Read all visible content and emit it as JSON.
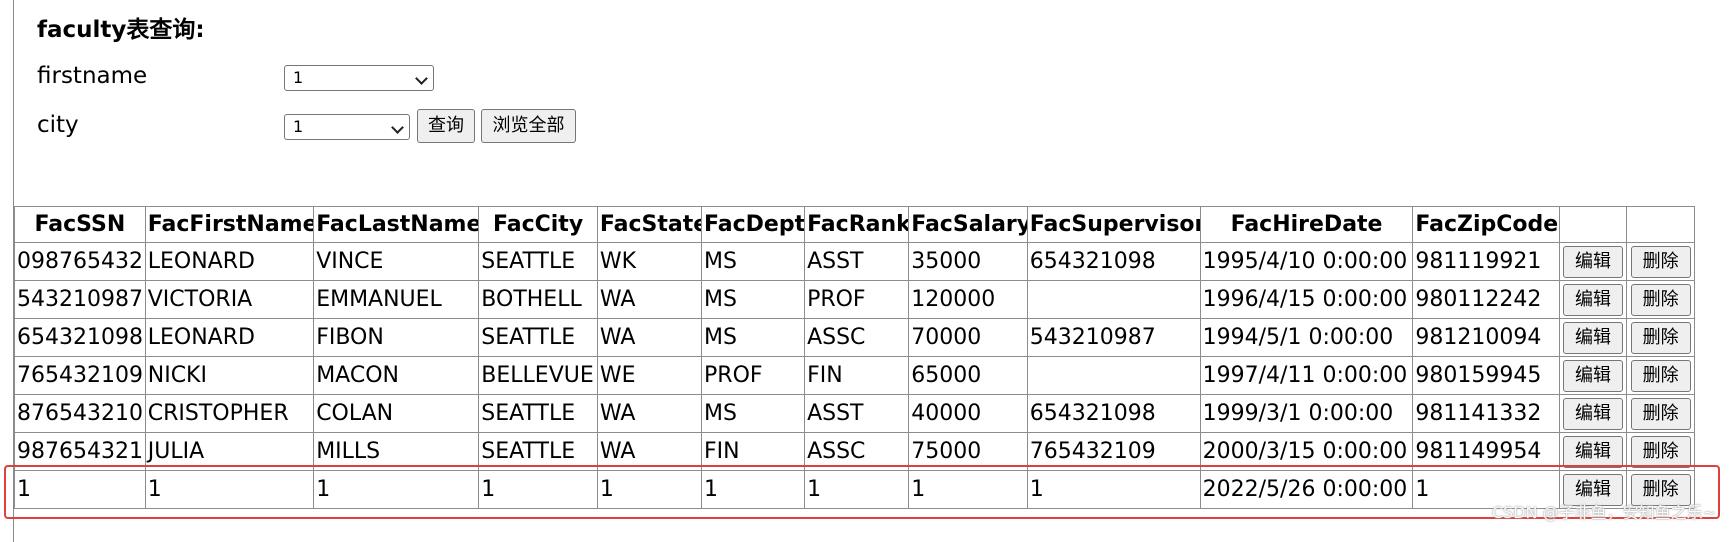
{
  "page": {
    "title": "faculty表查询:"
  },
  "form": {
    "firstname_label": "firstname",
    "firstname_value": "1",
    "city_label": "city",
    "city_value": "1",
    "query_button": "查询",
    "browse_all_button": "浏览全部"
  },
  "table": {
    "headers": [
      "FacSSN",
      "FacFirstName",
      "FacLastName",
      "FacCity",
      "FacState",
      "FacDept",
      "FacRank",
      "FacSalary",
      "FacSupervisor",
      "FacHireDate",
      "FacZipCode",
      "",
      ""
    ],
    "edit_label": "编辑",
    "delete_label": "删除",
    "rows": [
      [
        "098765432",
        "LEONARD",
        "VINCE",
        "SEATTLE",
        "WK",
        "MS",
        "ASST",
        "35000",
        "654321098",
        "1995/4/10 0:00:00",
        "981119921"
      ],
      [
        "543210987",
        "VICTORIA",
        "EMMANUEL",
        "BOTHELL",
        "WA",
        "MS",
        "PROF",
        "120000",
        "",
        "1996/4/15 0:00:00",
        "980112242"
      ],
      [
        "654321098",
        "LEONARD",
        "FIBON",
        "SEATTLE",
        "WA",
        "MS",
        "ASSC",
        "70000",
        "543210987",
        "1994/5/1 0:00:00",
        "981210094"
      ],
      [
        "765432109",
        "NICKI",
        "MACON",
        "BELLEVUE",
        "WE",
        "PROF",
        "FIN",
        "65000",
        "",
        "1997/4/11 0:00:00",
        "980159945"
      ],
      [
        "876543210",
        "CRISTOPHER",
        "COLAN",
        "SEATTLE",
        "WA",
        "MS",
        "ASST",
        "40000",
        "654321098",
        "1999/3/1 0:00:00",
        "981141332"
      ],
      [
        "987654321",
        "JULIA",
        "MILLS",
        "SEATTLE",
        "WA",
        "FIN",
        "ASSC",
        "75000",
        "765432109",
        "2000/3/15 0:00:00",
        "981149954"
      ],
      [
        "1",
        "1",
        "1",
        "1",
        "1",
        "1",
        "1",
        "1",
        "1",
        "2022/5/26 0:00:00",
        "1"
      ]
    ]
  },
  "watermark": "CSDN @子非鱼，安知鱼之乐~",
  "colors": {
    "highlight_border": "#e0403a",
    "button_bg": "#efefef",
    "table_border": "#8c8c8c"
  }
}
